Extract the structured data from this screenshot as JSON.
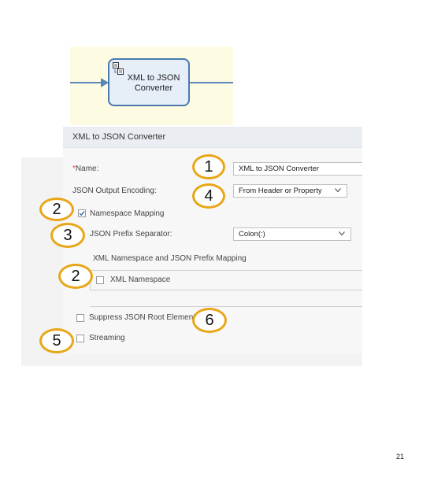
{
  "flow": {
    "node_label": "XML to JSON\nConverter",
    "node_icon": "xml-json-converter-icon"
  },
  "panel": {
    "title": "XML to JSON Converter",
    "name": {
      "required_mark": "*",
      "label": "Name:",
      "value": "XML to JSON Converter"
    },
    "json_output_encoding": {
      "label": "JSON Output Encoding:",
      "value": "From Header or Property"
    },
    "namespace_mapping": {
      "label": "Namespace Mapping",
      "checked": true
    },
    "json_prefix_separator": {
      "label": "JSON Prefix Separator:",
      "value": "Colon(:)"
    },
    "mapping_section": {
      "title": "XML Namespace and JSON Prefix Mapping",
      "column_header": "XML Namespace"
    },
    "suppress_root": {
      "label": "Suppress JSON Root Element",
      "checked": false
    },
    "streaming": {
      "label": "Streaming",
      "checked": false
    }
  },
  "callouts": {
    "name": "1",
    "namespace_mapping": "2",
    "prefix_separator": "3",
    "output_encoding": "4",
    "streaming": "5",
    "suppress_root": "6",
    "namespace_table": "2",
    "color": "#e8a618"
  },
  "footer": {
    "page_number": "21"
  }
}
